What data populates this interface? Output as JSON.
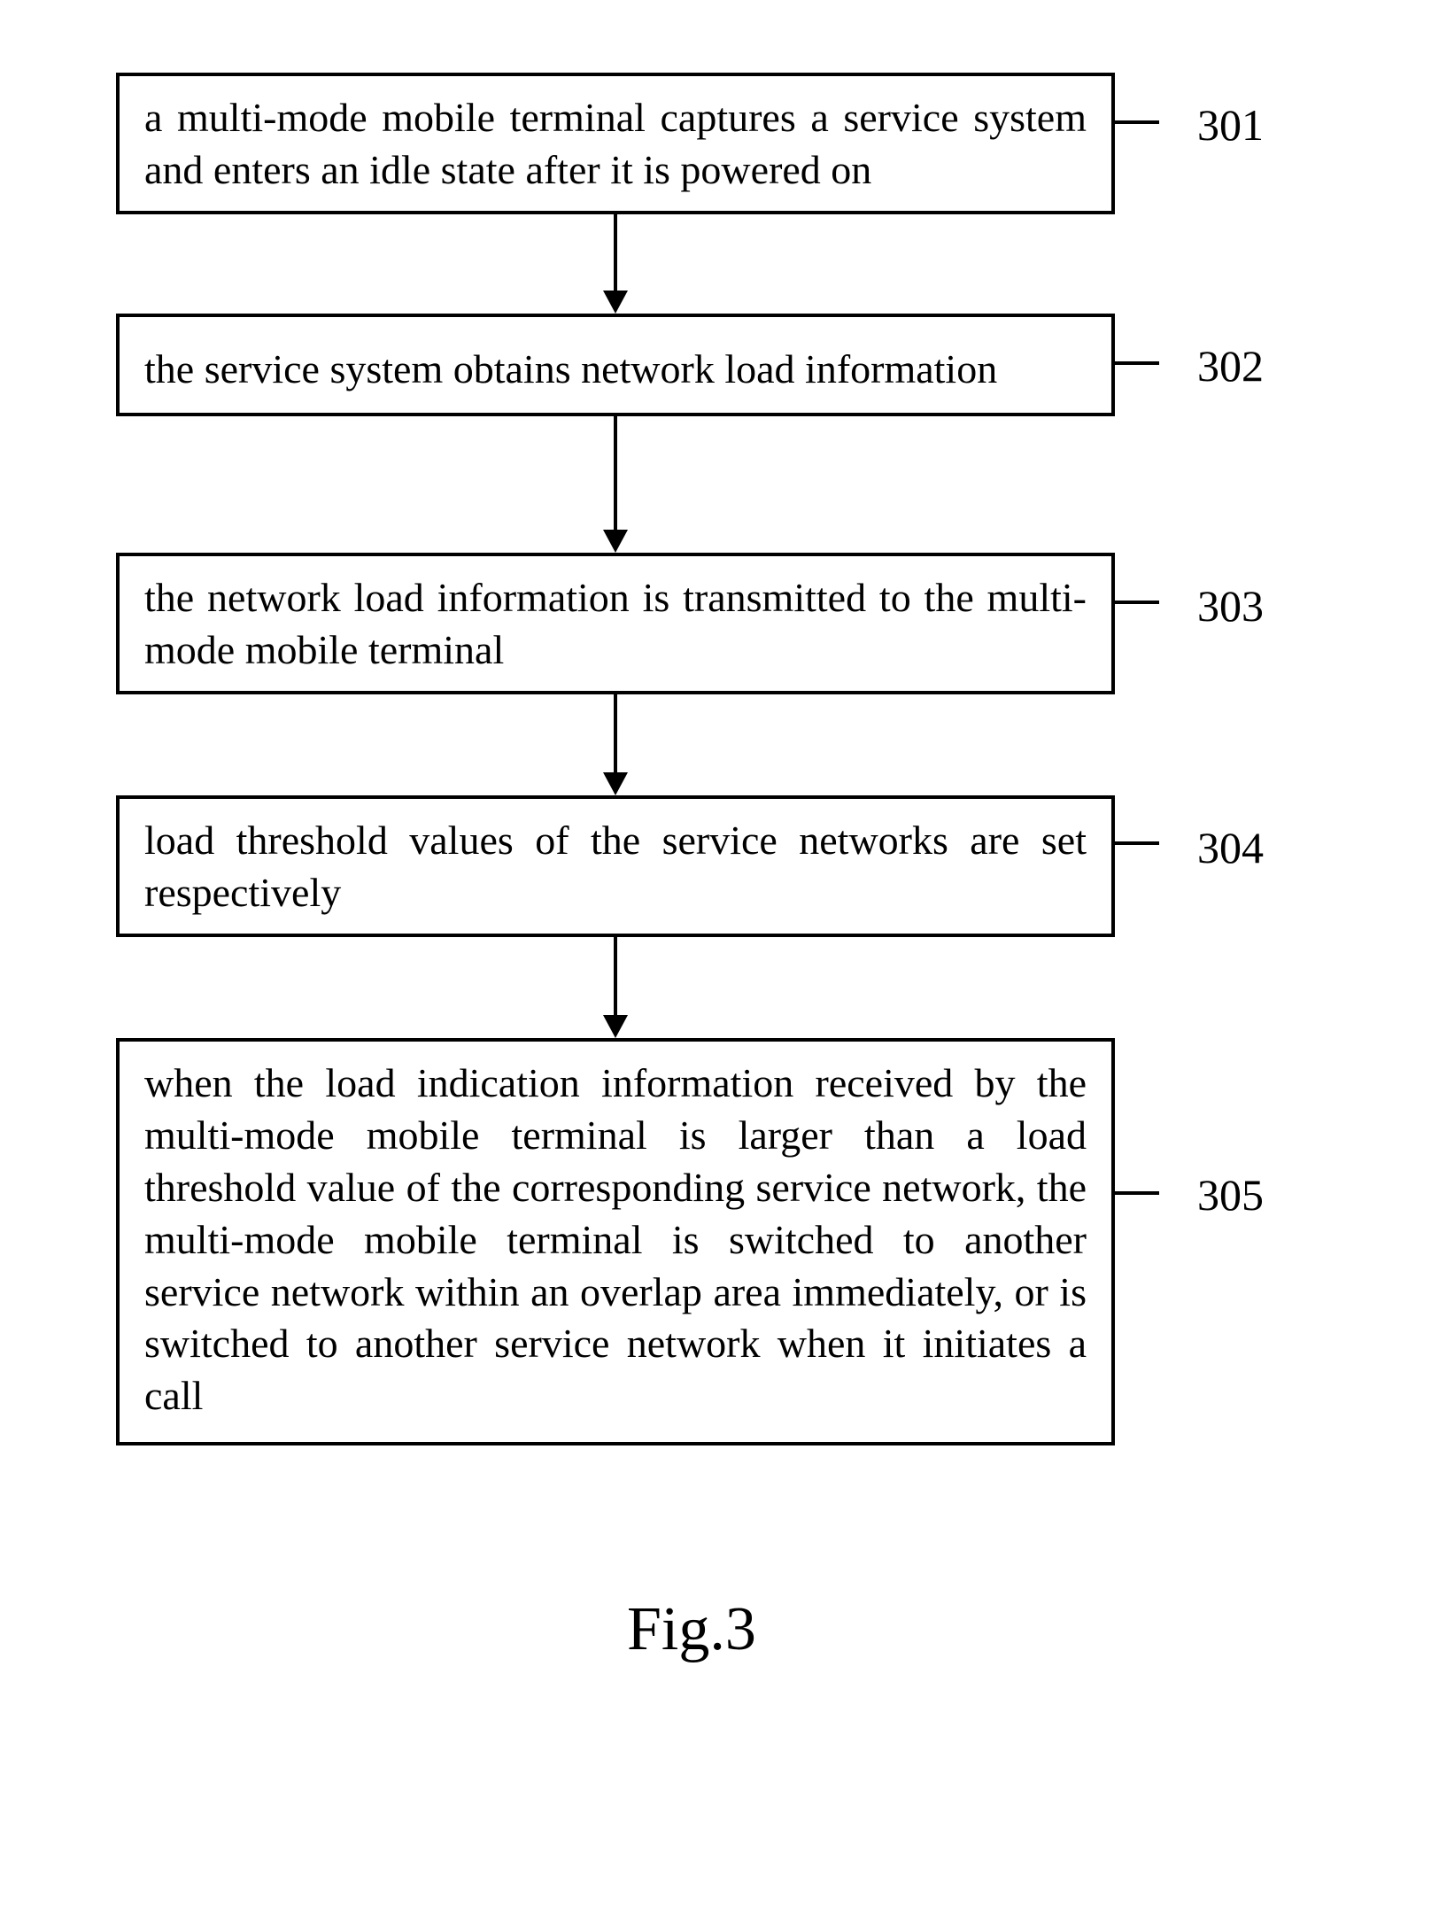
{
  "steps": [
    {
      "num": "301",
      "text": "a multi-mode mobile terminal captures a service system and enters an idle state after it is powered on"
    },
    {
      "num": "302",
      "text": "the service system obtains network load information"
    },
    {
      "num": "303",
      "text": "the network load information is transmitted to the multi-mode mobile terminal"
    },
    {
      "num": "304",
      "text": "load threshold values of the service networks are set respectively"
    },
    {
      "num": "305",
      "text": "when the load indication information received by the multi-mode mobile terminal is larger than a load threshold value of the corresponding service network, the multi-mode mobile terminal is switched to another service network within an overlap area immediately, or is switched to another service network when it initiates a call"
    }
  ],
  "caption": "Fig.3"
}
